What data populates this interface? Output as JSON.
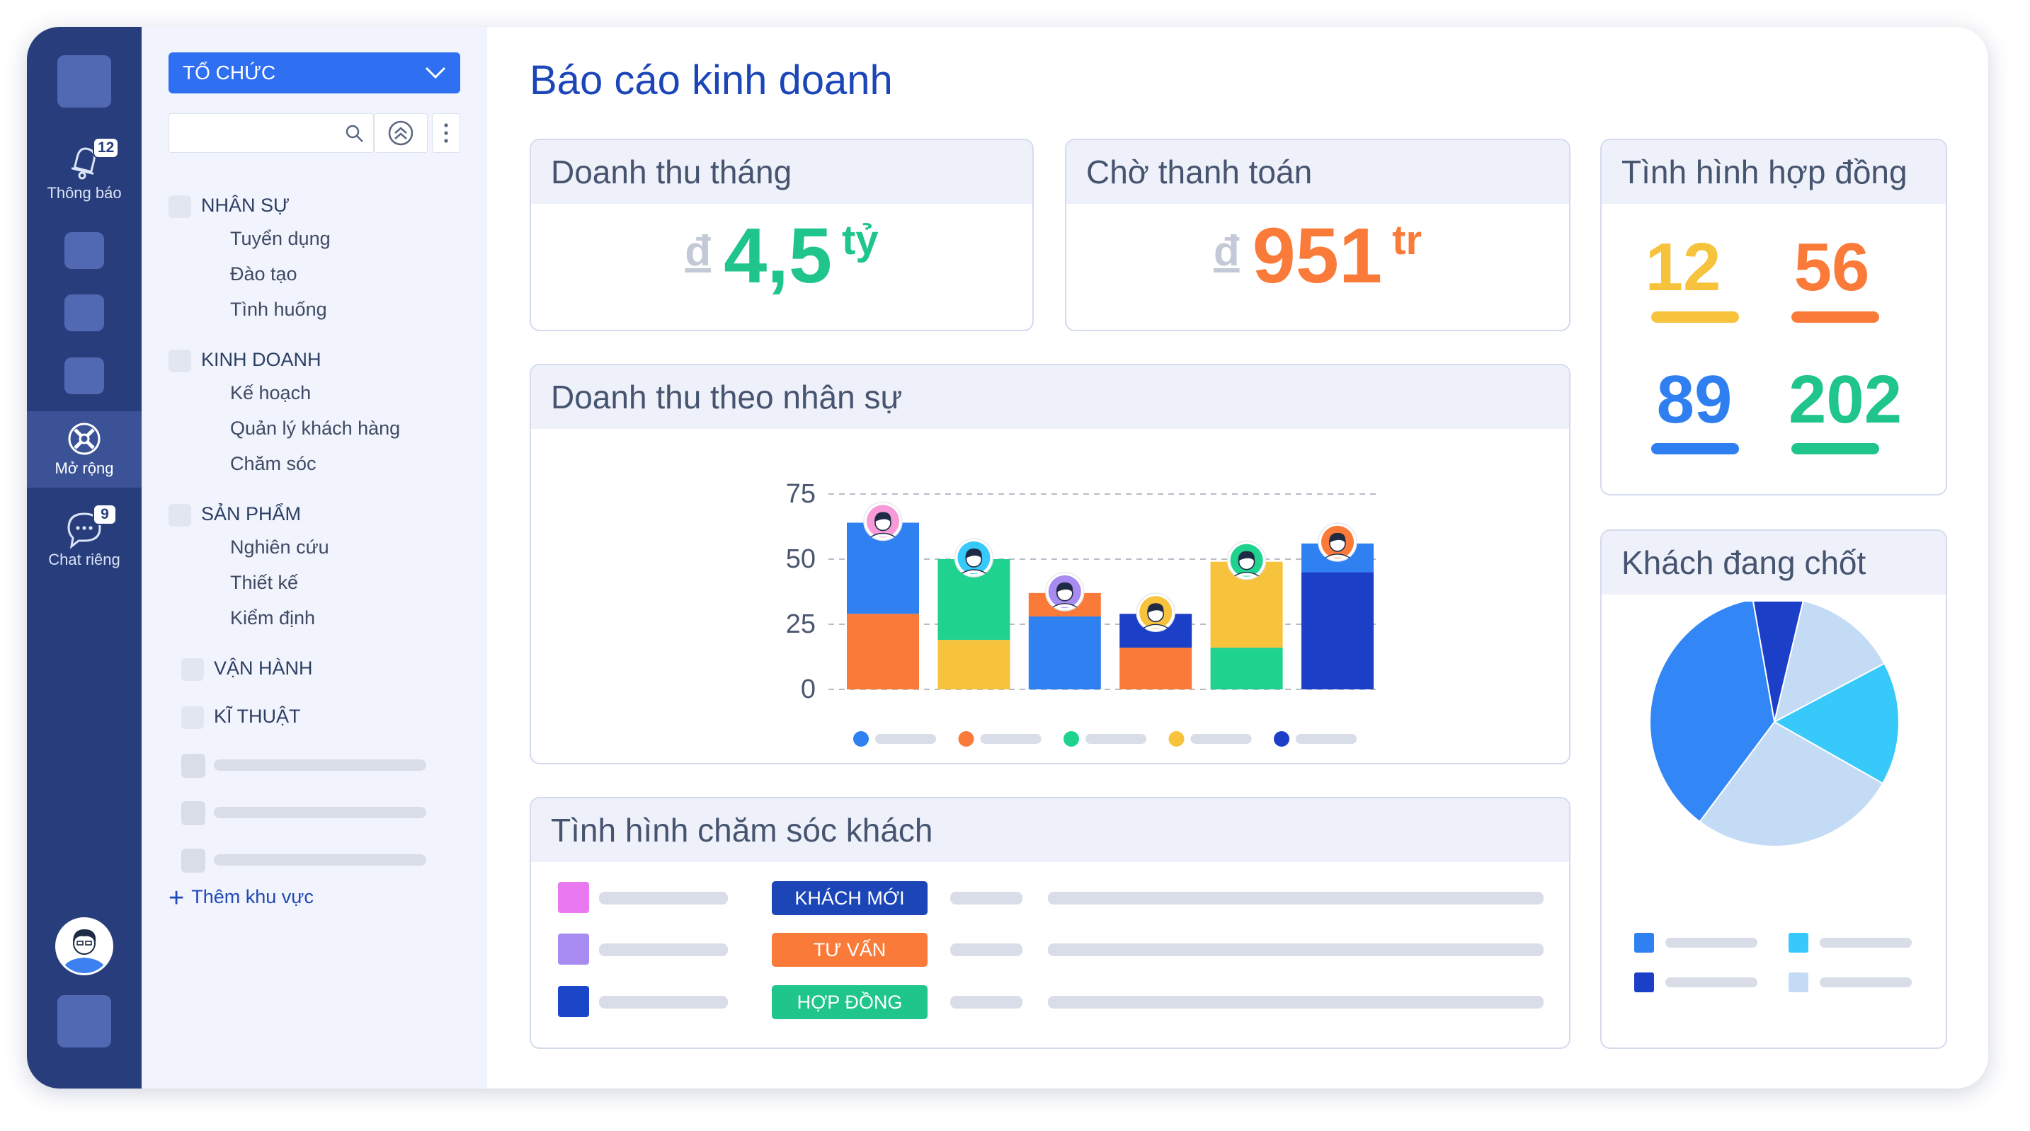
{
  "rail": {
    "notifications_label": "Thông báo",
    "notifications_badge": "12",
    "extend_label": "Mở rộng",
    "chat_label": "Chat riêng",
    "chat_badge": "9"
  },
  "sidebar": {
    "org_select": "TỔ CHỨC",
    "categories": [
      {
        "label": "NHÂN SỰ",
        "items": [
          "Tuyển dụng",
          "Đào tạo",
          "Tình huống"
        ]
      },
      {
        "label": "KINH DOANH",
        "items": [
          "Kế hoạch",
          "Quản lý khách hàng",
          "Chăm sóc"
        ]
      },
      {
        "label": "SẢN PHẨM",
        "items": [
          "Nghiên cứu",
          "Thiết kế",
          "Kiểm định"
        ]
      },
      {
        "label": "VẬN HÀNH",
        "items": []
      },
      {
        "label": "KĨ THUẬT",
        "items": []
      }
    ],
    "add_area": "Thêm khu vực"
  },
  "main": {
    "title": "Báo cáo kinh doanh",
    "revenue_month": {
      "title": "Doanh thu tháng",
      "currency": "đ",
      "value": "4,5",
      "unit": "tỷ",
      "color": "#1fc58a"
    },
    "pending_payment": {
      "title": "Chờ thanh toán",
      "currency": "đ",
      "value": "951",
      "unit": "tr",
      "color": "#fa7b39"
    },
    "contracts": {
      "title": "Tình hình hợp đồng",
      "values": [
        {
          "value": "12",
          "color": "#f7c23c"
        },
        {
          "value": "56",
          "color": "#fa7b39"
        },
        {
          "value": "89",
          "color": "#2f7ff0"
        },
        {
          "value": "202",
          "color": "#1fc58a"
        }
      ]
    },
    "revenue_by_staff": {
      "title": "Doanh thu theo nhân sự"
    },
    "customer_care": {
      "title": "Tình hình chăm sóc khách",
      "rows": [
        {
          "status": "KHÁCH MỚI",
          "status_color": "#1c46b8",
          "swatch": "#e879f0"
        },
        {
          "status": "TƯ VẤN",
          "status_color": "#fa7b39",
          "swatch": "#a78bf0"
        },
        {
          "status": "HỢP ĐỒNG",
          "status_color": "#1fc58a",
          "swatch": "#1c46c8"
        }
      ]
    },
    "closing_customers": {
      "title": "Khách đang chốt"
    }
  },
  "chart_data": {
    "type": "bar",
    "stacked": true,
    "yticks": [
      "75",
      "50",
      "25",
      "0"
    ],
    "ylim": [
      0,
      75
    ],
    "grid": true,
    "legend_position": "bottom",
    "series": [
      {
        "color": "#2f80f0",
        "values": [
          35,
          0,
          28,
          0,
          0,
          0
        ]
      },
      {
        "color": "#fa7b39",
        "values": [
          29,
          0,
          9,
          16,
          0,
          0
        ]
      },
      {
        "color": "#1fd38f",
        "values": [
          0,
          31,
          0,
          0,
          16,
          0
        ]
      },
      {
        "color": "#f7c23c",
        "values": [
          0,
          19,
          0,
          0,
          33,
          0
        ]
      },
      {
        "color": "#1c3fc8",
        "values": [
          0,
          0,
          0,
          13,
          0,
          45
        ]
      }
    ],
    "extra_segments": [
      {
        "bar": 5,
        "color": "#2f80f0",
        "value": 11
      }
    ]
  },
  "pie_data": {
    "type": "pie",
    "slices": [
      {
        "color": "#1c3fc8",
        "value": 6.5
      },
      {
        "color": "#c4dbf5",
        "value": 13.5
      },
      {
        "color": "#38c9fb",
        "value": 16
      },
      {
        "color": "#c4dbf5",
        "value": 27
      },
      {
        "color": "#3386f6",
        "value": 37
      }
    ],
    "legend_colors": [
      "#2f80f0",
      "#38c9fb",
      "#1c3fc8",
      "#c4dbf5"
    ]
  }
}
